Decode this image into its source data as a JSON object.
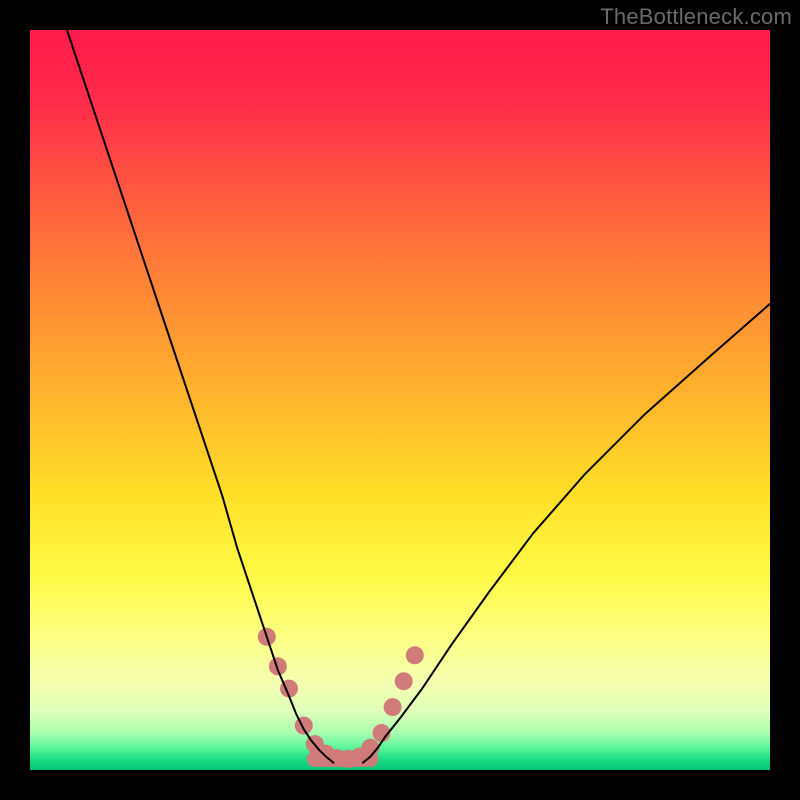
{
  "watermark": {
    "text": "TheBottleneck.com"
  },
  "chart_data": {
    "type": "line",
    "title": "",
    "xlabel": "",
    "ylabel": "",
    "xlim": [
      0,
      100
    ],
    "ylim": [
      0,
      100
    ],
    "background": {
      "gradient_direction": "vertical",
      "stops": [
        {
          "pos": 0.0,
          "color": "#ff1a4b"
        },
        {
          "pos": 0.22,
          "color": "#ff5a3f"
        },
        {
          "pos": 0.5,
          "color": "#ffb62d"
        },
        {
          "pos": 0.74,
          "color": "#fffb48"
        },
        {
          "pos": 0.92,
          "color": "#dfffb8"
        },
        {
          "pos": 1.0,
          "color": "#06c675"
        }
      ]
    },
    "series": [
      {
        "name": "left-branch",
        "color": "#000000",
        "stroke_width": 2,
        "x": [
          5,
          8,
          11,
          14,
          17,
          20,
          23,
          26,
          28,
          30,
          32,
          33.5,
          35,
          36,
          37,
          38,
          39,
          40,
          41
        ],
        "y": [
          100,
          91,
          82,
          73,
          64,
          55,
          46,
          37,
          30,
          24,
          18,
          13.5,
          10,
          7.5,
          5.5,
          4,
          2.8,
          1.8,
          1
        ]
      },
      {
        "name": "right-branch",
        "color": "#000000",
        "stroke_width": 2,
        "x": [
          45,
          46,
          47,
          48,
          50,
          53,
          57,
          62,
          68,
          75,
          83,
          92,
          100
        ],
        "y": [
          1,
          1.8,
          3,
          4.5,
          7,
          11,
          17,
          24,
          32,
          40,
          48,
          56,
          63
        ]
      }
    ],
    "markers": {
      "color": "#d07a79",
      "radius": 9,
      "points": [
        {
          "x": 32.0,
          "y": 18.0
        },
        {
          "x": 33.5,
          "y": 14.0
        },
        {
          "x": 35.0,
          "y": 11.0
        },
        {
          "x": 37.0,
          "y": 6.0
        },
        {
          "x": 38.5,
          "y": 3.5
        },
        {
          "x": 40.0,
          "y": 2.2
        },
        {
          "x": 41.5,
          "y": 1.6
        },
        {
          "x": 43.0,
          "y": 1.5
        },
        {
          "x": 44.5,
          "y": 1.8
        },
        {
          "x": 46.0,
          "y": 3.0
        },
        {
          "x": 47.5,
          "y": 5.0
        },
        {
          "x": 49.0,
          "y": 8.5
        },
        {
          "x": 50.5,
          "y": 12.0
        },
        {
          "x": 52.0,
          "y": 15.5
        }
      ]
    },
    "floor_segment": {
      "color": "#d07a79",
      "stroke_width": 16,
      "x_start": 38.5,
      "x_end": 46.0,
      "y": 1.5
    }
  }
}
